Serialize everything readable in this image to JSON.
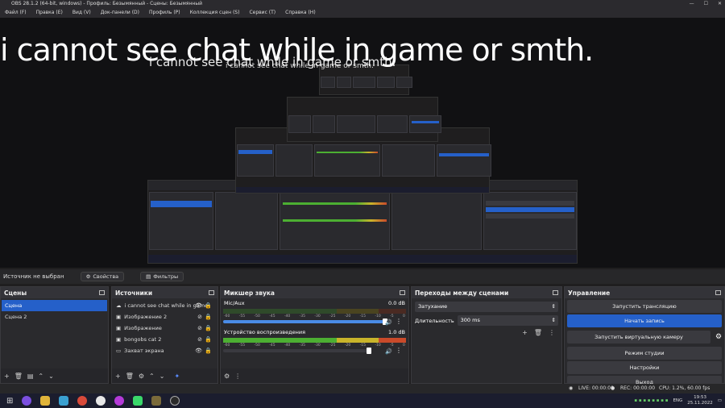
{
  "window": {
    "title": "OBS 28.1.2 (64-bit, windows) - Профиль: Безымянный - Сцены: Безымянный"
  },
  "menu": [
    "Файл (F)",
    "Правка (E)",
    "Вид (V)",
    "Док-панели (D)",
    "Профиль (P)",
    "Коллекция сцен (S)",
    "Сервис (T)",
    "Справка (H)"
  ],
  "preview": {
    "caption": "i cannot see chat while in game or smth.",
    "caption_small": "i cannot see chat while in game or smth.",
    "caption_tiny": "i cannot see chat while in game or smth."
  },
  "source_bar": {
    "label": "Источник не выбран",
    "properties": "Свойства",
    "filters": "Фильтры"
  },
  "scenes": {
    "title": "Сцены",
    "items": [
      "Сцена",
      "Сцена 2"
    ]
  },
  "sources": {
    "title": "Источники",
    "items": [
      {
        "name": "i cannot see chat while in game",
        "icon": "text-icon",
        "hidden": false
      },
      {
        "name": "Изображение 2",
        "icon": "image-icon",
        "hidden": true
      },
      {
        "name": "Изображение",
        "icon": "image-icon",
        "hidden": true
      },
      {
        "name": "bongobs cat 2",
        "icon": "image-icon",
        "hidden": true
      },
      {
        "name": "Захват экрана",
        "icon": "monitor-icon",
        "hidden": false
      }
    ]
  },
  "mixer": {
    "title": "Микшер звука",
    "channels": [
      {
        "name": "Mic/Aux",
        "db": "0.0 dB"
      },
      {
        "name": "Устройство воспроизведения",
        "db": "1.0 dB"
      }
    ],
    "ticks": [
      "-60",
      "-55",
      "-50",
      "-45",
      "-40",
      "-35",
      "-30",
      "-25",
      "-20",
      "-15",
      "-10",
      "-5",
      "0"
    ]
  },
  "transitions": {
    "title": "Переходы между сценами",
    "type": "Затухание",
    "duration_label": "Длительность",
    "duration": "300 ms"
  },
  "controls": {
    "title": "Управление",
    "start_stream": "Запустить трансляцию",
    "start_record": "Начать запись",
    "virtual_cam": "Запустить виртуальную камеру",
    "studio_mode": "Режим студии",
    "settings": "Настройки",
    "exit": "Выход"
  },
  "status": {
    "live": "LIVE: 00:00:00",
    "rec": "REC: 00:00:00",
    "cpu": "CPU: 1.2%, 60.00 fps"
  },
  "taskbar": {
    "lang": "ENG",
    "time": "19:53",
    "date": "25.11.2022"
  },
  "colors": {
    "accent": "#2560c9",
    "meter_green": "#4caf32",
    "meter_yellow": "#c9b42a",
    "meter_red": "#c94a2a"
  }
}
